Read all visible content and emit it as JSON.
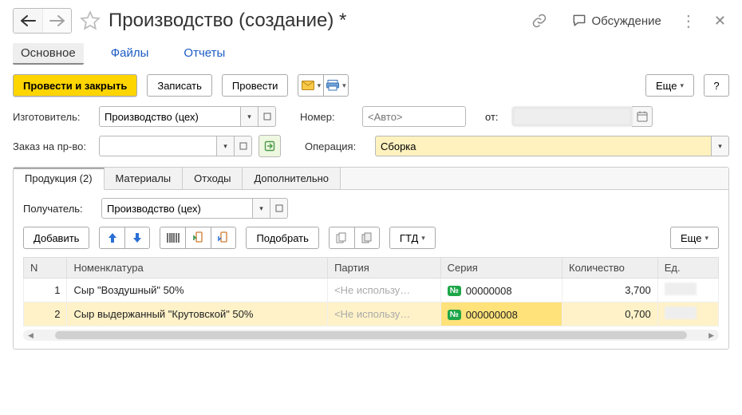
{
  "title": "Производство (создание) *",
  "discussion_label": "Обсуждение",
  "section_tabs": {
    "main": "Основное",
    "files": "Файлы",
    "reports": "Отчеты"
  },
  "command_bar": {
    "post_close": "Провести и закрыть",
    "save": "Записать",
    "post": "Провести",
    "more": "Еще",
    "help": "?"
  },
  "form": {
    "manufacturer_label": "Изготовитель:",
    "manufacturer_value": "Производство (цех)",
    "number_label": "Номер:",
    "number_placeholder": "<Авто>",
    "from_label": "от:",
    "order_label": "Заказ на пр-во:",
    "order_value": "",
    "operation_label": "Операция:",
    "operation_value": "Сборка"
  },
  "tabs": {
    "products": "Продукция (2)",
    "materials": "Материалы",
    "waste": "Отходы",
    "more": "Дополнительно"
  },
  "products_panel": {
    "recipient_label": "Получатель:",
    "recipient_value": "Производство (цех)",
    "buttons": {
      "add": "Добавить",
      "pick": "Подобрать",
      "gtd": "ГТД",
      "more": "Еще"
    }
  },
  "columns": {
    "n": "N",
    "nomenclature": "Номенклатура",
    "part": "Партия",
    "series": "Серия",
    "qty": "Количество",
    "unit": "Ед."
  },
  "rows": [
    {
      "n": "1",
      "name": "Сыр \"Воздушный\" 50%",
      "part": "<Не использу…",
      "no_badge": "№",
      "serial": "00000008",
      "qty": "3,700"
    },
    {
      "n": "2",
      "name": "Сыр выдержанный \"Крутовской\" 50%",
      "part": "<Не использу…",
      "no_badge": "№",
      "serial": "000000008",
      "qty": "0,700"
    }
  ]
}
